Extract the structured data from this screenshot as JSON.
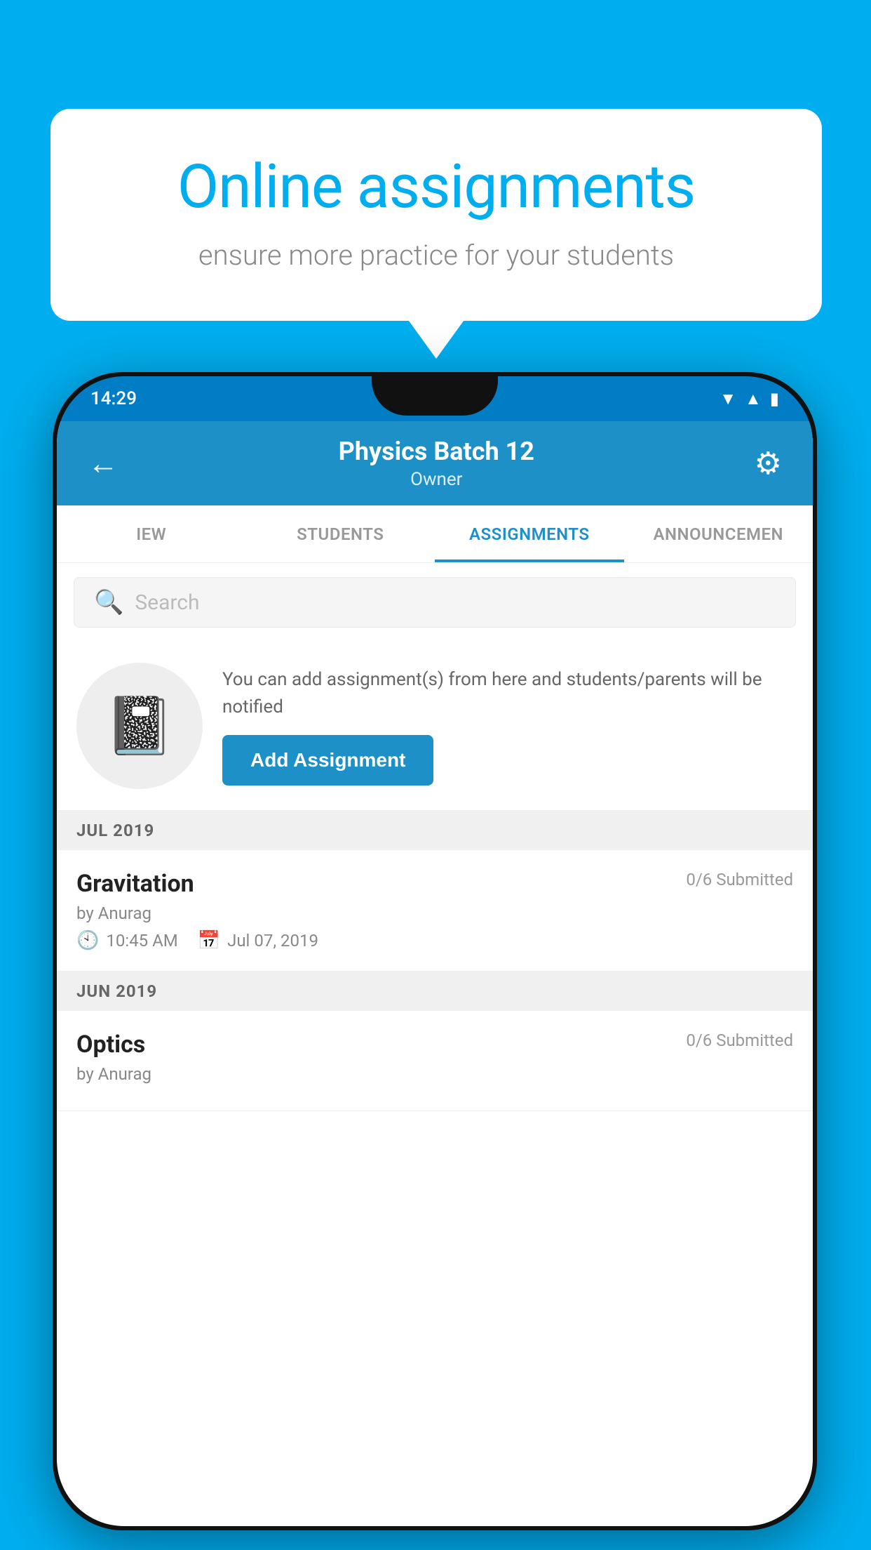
{
  "background": {
    "color": "#00AEEF"
  },
  "speech_bubble": {
    "title": "Online assignments",
    "subtitle": "ensure more practice for your students"
  },
  "app_bar": {
    "title": "Physics Batch 12",
    "subtitle": "Owner",
    "back_label": "←",
    "gear_label": "⚙"
  },
  "tabs": [
    {
      "label": "IEW",
      "active": false
    },
    {
      "label": "STUDENTS",
      "active": false
    },
    {
      "label": "ASSIGNMENTS",
      "active": true
    },
    {
      "label": "ANNOUNCEMENTS",
      "active": false
    }
  ],
  "search": {
    "placeholder": "Search"
  },
  "promo": {
    "description": "You can add assignment(s) from here and students/parents will be notified",
    "button_label": "Add Assignment"
  },
  "status_bar": {
    "time": "14:29"
  },
  "sections": [
    {
      "header": "JUL 2019",
      "assignments": [
        {
          "name": "Gravitation",
          "submitted": "0/6 Submitted",
          "by": "by Anurag",
          "time": "10:45 AM",
          "date": "Jul 07, 2019"
        }
      ]
    },
    {
      "header": "JUN 2019",
      "assignments": [
        {
          "name": "Optics",
          "submitted": "0/6 Submitted",
          "by": "by Anurag",
          "time": "",
          "date": ""
        }
      ]
    }
  ]
}
